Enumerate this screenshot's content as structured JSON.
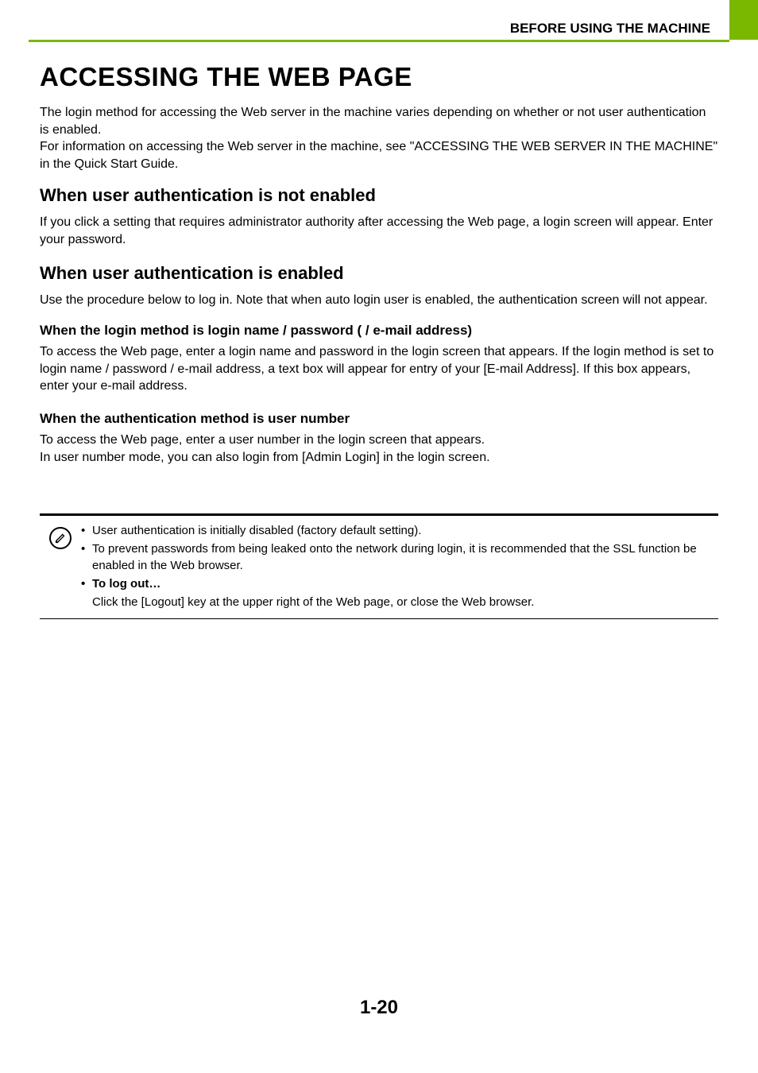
{
  "header": {
    "section_title": "BEFORE USING THE MACHINE"
  },
  "main": {
    "title": "ACCESSING THE WEB PAGE",
    "intro": "The login method for accessing the Web server in the machine varies depending on whether or not user authentication is enabled.\nFor information on accessing the Web server in the machine, see \"ACCESSING THE WEB SERVER IN THE MACHINE\" in the Quick Start Guide.",
    "section1": {
      "heading": "When user authentication is not enabled",
      "text": "If you click a setting that requires administrator authority after accessing the Web page, a login screen will appear. Enter your password."
    },
    "section2": {
      "heading": "When user authentication is enabled",
      "text": "Use the procedure below to log in. Note that when auto login user is enabled, the authentication screen will not appear.",
      "sub1": {
        "heading": "When the login method is login name / password ( / e-mail address)",
        "text": "To access the Web page, enter a login name and password in the login screen that appears. If the login method is set to login name / password / e-mail address, a text box will appear for entry of your [E-mail Address]. If this box appears, enter your e-mail address."
      },
      "sub2": {
        "heading": "When the authentication method is user number",
        "text": "To access the Web page, enter a user number in the login screen that appears.\nIn user number mode, you can also login from [Admin Login] in the login screen."
      }
    },
    "note": {
      "bullet1": "User authentication is initially disabled (factory default setting).",
      "bullet2": "To prevent passwords from being leaked onto the network during login, it is recommended that the SSL function be enabled in the Web browser.",
      "bullet3_label": "To log out…",
      "bullet3_text": "Click the [Logout] key at the upper right of the Web page, or close the Web browser."
    }
  },
  "footer": {
    "page_number": "1-20"
  }
}
